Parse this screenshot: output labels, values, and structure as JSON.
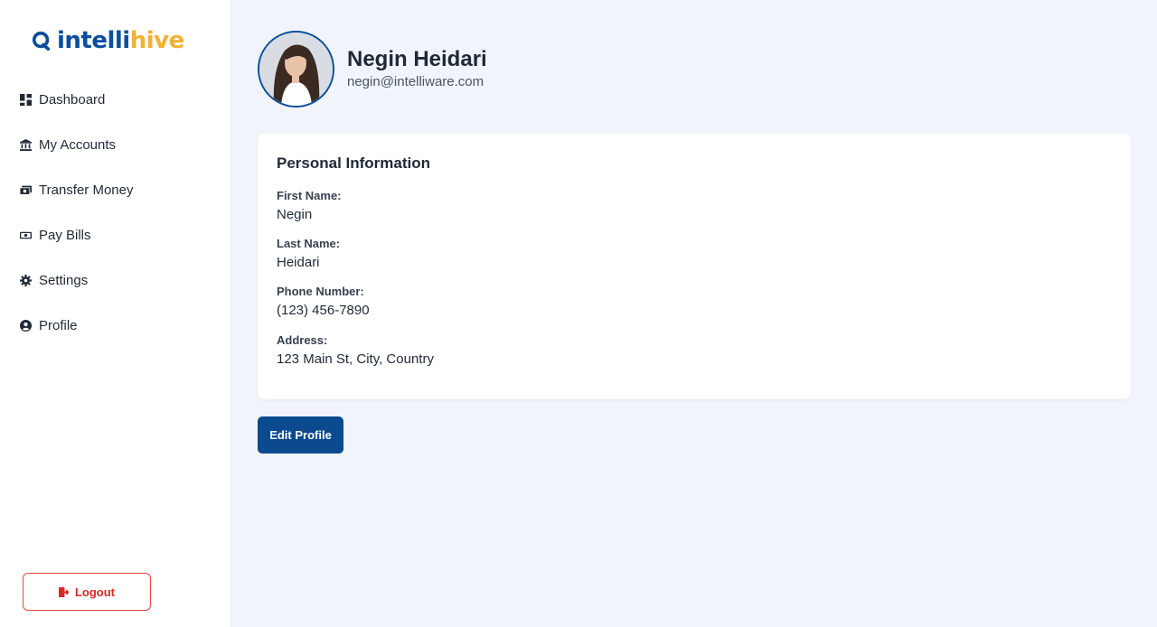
{
  "brand": {
    "name_part1": "intelli",
    "name_part2": "hive",
    "primary_color": "#0b4f9c",
    "accent_color": "#f2b134"
  },
  "sidebar": {
    "items": [
      {
        "label": "Dashboard",
        "icon": "dashboard-icon"
      },
      {
        "label": "My Accounts",
        "icon": "bank-icon"
      },
      {
        "label": "Transfer Money",
        "icon": "money-transfer-icon"
      },
      {
        "label": "Pay Bills",
        "icon": "bills-icon"
      },
      {
        "label": "Settings",
        "icon": "gear-icon"
      },
      {
        "label": "Profile",
        "icon": "user-circle-icon"
      }
    ],
    "logout_label": "Logout"
  },
  "profile": {
    "name": "Negin Heidari",
    "email": "negin@intelliware.com"
  },
  "personal_info": {
    "title": "Personal Information",
    "fields": [
      {
        "label": "First Name:",
        "value": "Negin"
      },
      {
        "label": "Last Name:",
        "value": "Heidari"
      },
      {
        "label": "Phone Number:",
        "value": "(123) 456-7890"
      },
      {
        "label": "Address:",
        "value": "123 Main St, City, Country"
      }
    ]
  },
  "actions": {
    "edit_label": "Edit Profile"
  }
}
